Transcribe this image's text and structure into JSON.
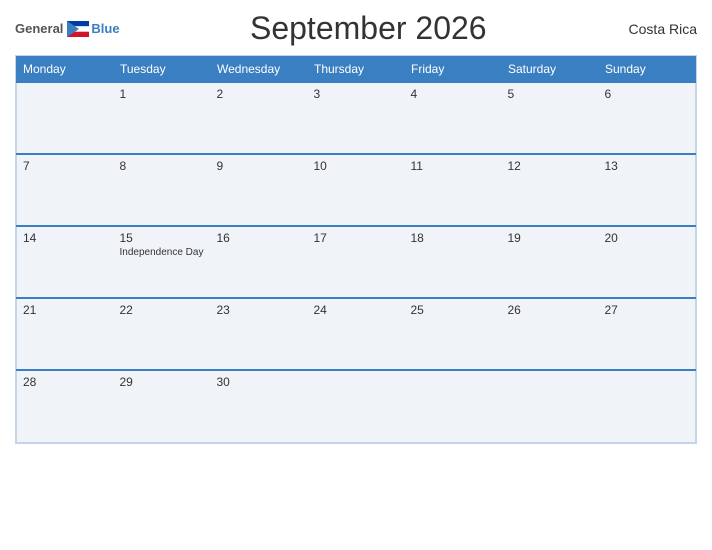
{
  "header": {
    "logo_general": "General",
    "logo_blue": "Blue",
    "title": "September 2026",
    "country": "Costa Rica"
  },
  "days_header": [
    "Monday",
    "Tuesday",
    "Wednesday",
    "Thursday",
    "Friday",
    "Saturday",
    "Sunday"
  ],
  "weeks": [
    [
      {
        "date": "",
        "event": ""
      },
      {
        "date": "1",
        "event": ""
      },
      {
        "date": "2",
        "event": ""
      },
      {
        "date": "3",
        "event": ""
      },
      {
        "date": "4",
        "event": ""
      },
      {
        "date": "5",
        "event": ""
      },
      {
        "date": "6",
        "event": ""
      }
    ],
    [
      {
        "date": "7",
        "event": ""
      },
      {
        "date": "8",
        "event": ""
      },
      {
        "date": "9",
        "event": ""
      },
      {
        "date": "10",
        "event": ""
      },
      {
        "date": "11",
        "event": ""
      },
      {
        "date": "12",
        "event": ""
      },
      {
        "date": "13",
        "event": ""
      }
    ],
    [
      {
        "date": "14",
        "event": ""
      },
      {
        "date": "15",
        "event": "Independence Day"
      },
      {
        "date": "16",
        "event": ""
      },
      {
        "date": "17",
        "event": ""
      },
      {
        "date": "18",
        "event": ""
      },
      {
        "date": "19",
        "event": ""
      },
      {
        "date": "20",
        "event": ""
      }
    ],
    [
      {
        "date": "21",
        "event": ""
      },
      {
        "date": "22",
        "event": ""
      },
      {
        "date": "23",
        "event": ""
      },
      {
        "date": "24",
        "event": ""
      },
      {
        "date": "25",
        "event": ""
      },
      {
        "date": "26",
        "event": ""
      },
      {
        "date": "27",
        "event": ""
      }
    ],
    [
      {
        "date": "28",
        "event": ""
      },
      {
        "date": "29",
        "event": ""
      },
      {
        "date": "30",
        "event": ""
      },
      {
        "date": "",
        "event": ""
      },
      {
        "date": "",
        "event": ""
      },
      {
        "date": "",
        "event": ""
      },
      {
        "date": "",
        "event": ""
      }
    ]
  ]
}
